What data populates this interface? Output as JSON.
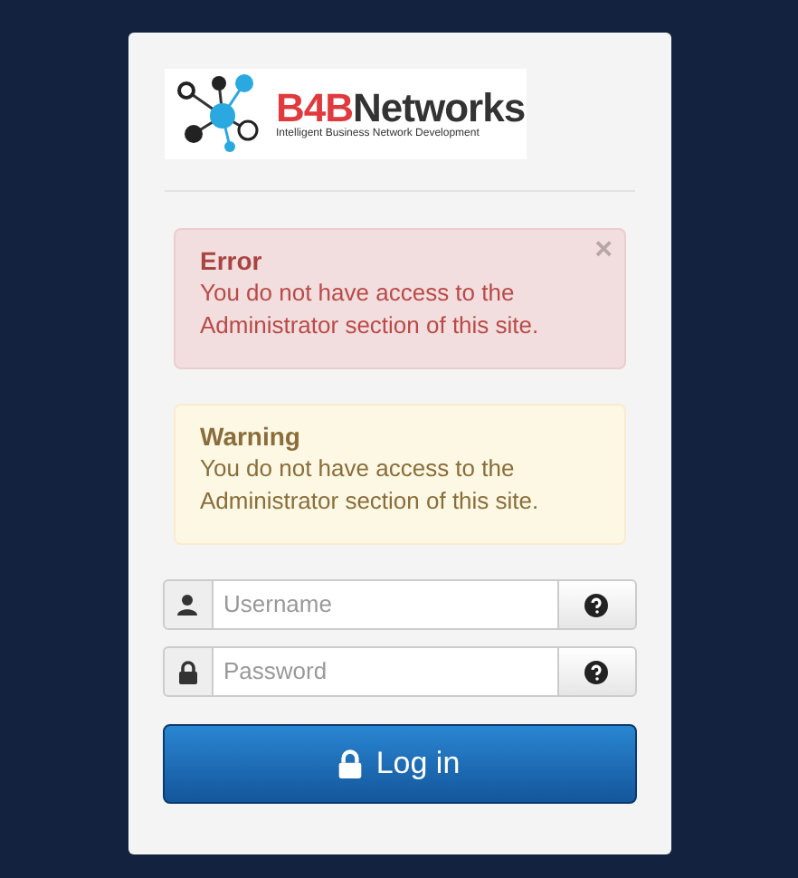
{
  "logo": {
    "prefix": "B4B",
    "name": "Networks",
    "tagline": "Intelligent Business Network Development"
  },
  "alerts": [
    {
      "kind": "error",
      "title": "Error",
      "message": "You do not have access to the Administrator section of this site.",
      "close": "×"
    },
    {
      "kind": "warning",
      "title": "Warning",
      "message": "You do not have access to the Administrator section of this site."
    }
  ],
  "fields": [
    {
      "kind": "user",
      "placeholder": "Username"
    },
    {
      "kind": "lock",
      "placeholder": "Password"
    }
  ],
  "login_button": "Log in"
}
